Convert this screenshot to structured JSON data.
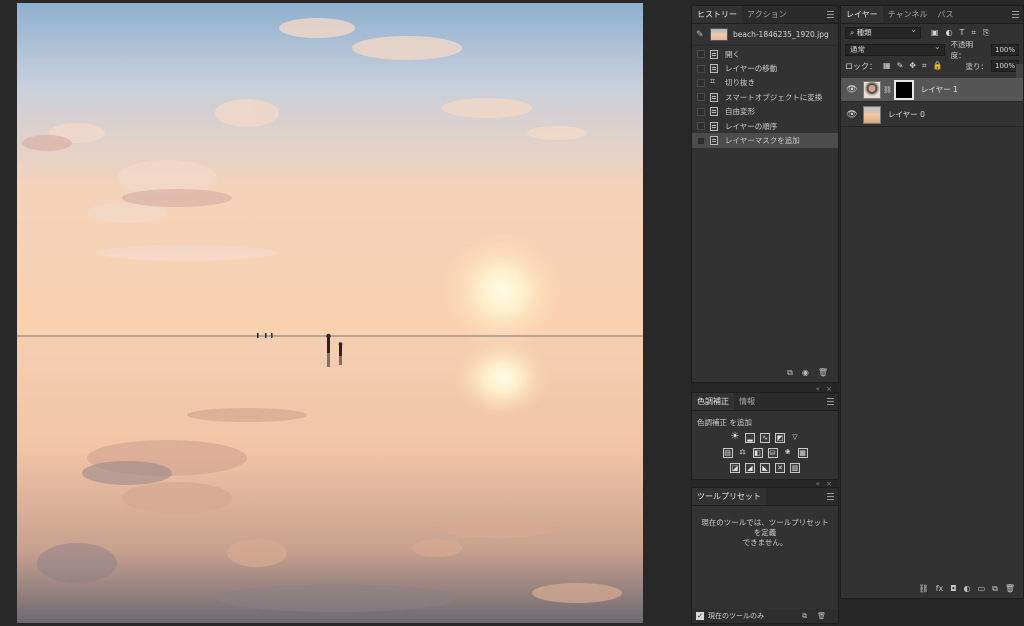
{
  "history_panel": {
    "tabs": [
      {
        "label": "ヒストリー",
        "active": true
      },
      {
        "label": "アクション",
        "active": false
      }
    ],
    "snapshot_filename": "beach-1846235_1920.jpg",
    "items": [
      {
        "label": "開く",
        "icon": "document-icon",
        "selected": false
      },
      {
        "label": "レイヤーの移動",
        "icon": "document-icon",
        "selected": false
      },
      {
        "label": "切り抜き",
        "icon": "crop-icon",
        "selected": false
      },
      {
        "label": "スマートオブジェクトに変換",
        "icon": "document-icon",
        "selected": false
      },
      {
        "label": "自由変形",
        "icon": "document-icon",
        "selected": false
      },
      {
        "label": "レイヤーの順序",
        "icon": "document-icon",
        "selected": false
      },
      {
        "label": "レイヤーマスクを追加",
        "icon": "document-icon",
        "selected": true
      }
    ],
    "footer_icons": [
      "new-document-from-state-icon",
      "camera-icon",
      "trash-icon"
    ]
  },
  "adjustments_panel": {
    "tabs": [
      {
        "label": "色調補正",
        "active": true
      },
      {
        "label": "情報",
        "active": false
      }
    ],
    "caption": "色調補正 を追加"
  },
  "tool_presets_panel": {
    "tabs": [
      {
        "label": "ツールプリセット",
        "active": true
      }
    ],
    "message_line1": "現在のツールでは、ツールプリセットを定義",
    "message_line2": "できません。",
    "current_tool_only_label": "現在のツールのみ",
    "current_tool_only_checked": true
  },
  "layers_panel": {
    "tabs": [
      {
        "label": "レイヤー",
        "active": true
      },
      {
        "label": "チャンネル",
        "active": false
      },
      {
        "label": "パス",
        "active": false
      }
    ],
    "filter_kind": "種類",
    "blend_mode": "通常",
    "opacity_label": "不透明度：",
    "opacity_value": "100%",
    "lock_label": "ロック：",
    "fill_label": "塗り：",
    "fill_value": "100%",
    "layers": [
      {
        "name": "レイヤー 1",
        "selected": true,
        "has_mask": true,
        "visible": true
      },
      {
        "name": "レイヤー 0",
        "selected": false,
        "has_mask": false,
        "visible": true
      }
    ]
  },
  "colors": {
    "app_background": "#282828",
    "panel_background": "#323232",
    "selected_row": "#565656"
  }
}
